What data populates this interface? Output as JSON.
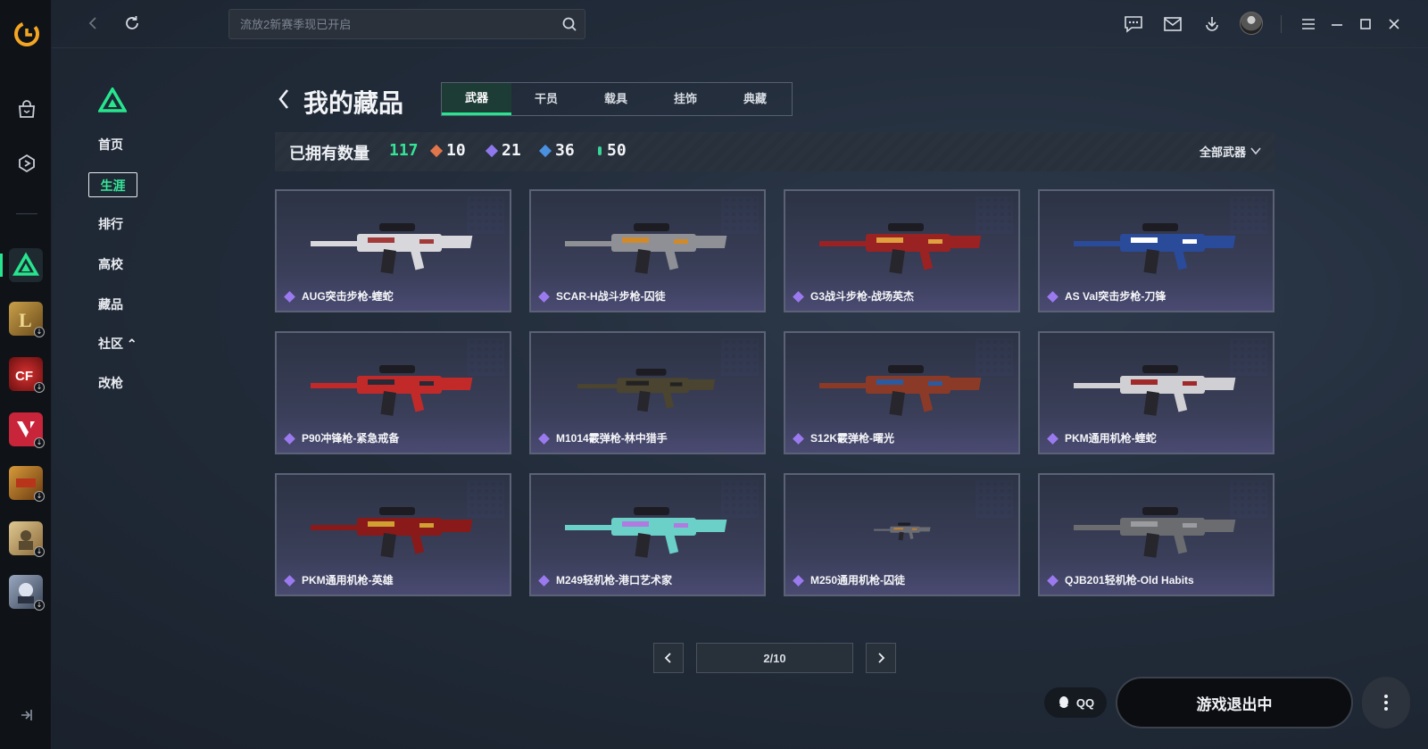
{
  "search": {
    "placeholder": "流放2新赛季现已开启"
  },
  "sidebar_nav": {
    "items": [
      {
        "label": "首页"
      },
      {
        "label": "生涯"
      },
      {
        "label": "排行"
      },
      {
        "label": "高校"
      },
      {
        "label": "藏品"
      },
      {
        "label": "社区 ⌃"
      },
      {
        "label": "改枪"
      }
    ]
  },
  "header": {
    "title": "我的藏品"
  },
  "tabs": [
    {
      "label": "武器",
      "active": true
    },
    {
      "label": "干员",
      "active": false
    },
    {
      "label": "载具",
      "active": false
    },
    {
      "label": "挂饰",
      "active": false
    },
    {
      "label": "典藏",
      "active": false
    }
  ],
  "stats": {
    "label": "已拥有数量",
    "total": "117",
    "counts": [
      {
        "value": "10",
        "color": "#e0764a"
      },
      {
        "value": "21",
        "color": "#8f78ee"
      },
      {
        "value": "36",
        "color": "#4a8fe0"
      },
      {
        "value": "50",
        "color": "#39d49a"
      }
    ],
    "filter_label": "全部武器"
  },
  "items": [
    {
      "name": "AUG突击步枪-蝰蛇",
      "gun_color": "#d8d8dc",
      "accent": "#a23a3a"
    },
    {
      "name": "SCAR-H战斗步枪-囚徒",
      "gun_color": "#8e9096",
      "accent": "#d08a2a"
    },
    {
      "name": "G3战斗步枪-战场英杰",
      "gun_color": "#9a2222",
      "accent": "#e0a040"
    },
    {
      "name": "AS Val突击步枪-刀锋",
      "gun_color": "#2a4a9a",
      "accent": "#ffffff"
    },
    {
      "name": "P90冲锋枪-紧急戒备",
      "gun_color": "#c22a2a",
      "accent": "#2a2a36"
    },
    {
      "name": "M1014霰弹枪-林中猎手",
      "gun_color": "#4a4430",
      "accent": "#222222"
    },
    {
      "name": "S12K霰弹枪-曙光",
      "gun_color": "#8a3a26",
      "accent": "#2a5aa0"
    },
    {
      "name": "PKM通用机枪-蝰蛇",
      "gun_color": "#d0d0d4",
      "accent": "#a02a2a"
    },
    {
      "name": "PKM通用机枪-英雄",
      "gun_color": "#8a1a1a",
      "accent": "#d0a030"
    },
    {
      "name": "M249轻机枪-港口艺术家",
      "gun_color": "#6ad0c8",
      "accent": "#b07ae0"
    },
    {
      "name": "M250通用机枪-囚徒",
      "gun_color": "#6a6c72",
      "accent": "#c08030"
    },
    {
      "name": "QJB201轻机枪-Old Habits",
      "gun_color": "#6a6c70",
      "accent": "#9a9ca0"
    }
  ],
  "pagination": {
    "label": "2/10"
  },
  "footer": {
    "qq_label": "QQ",
    "exit_label": "游戏退出中"
  },
  "colors": {
    "accent_green": "#27e58f"
  },
  "icons": [
    "brand-logo-icon",
    "store-icon",
    "voucher-icon",
    "back-icon",
    "refresh-icon",
    "search-icon",
    "chat-icon",
    "mail-icon",
    "download-icon",
    "menu-icon",
    "minimize-icon",
    "maximize-icon",
    "close-icon",
    "chevron-down-icon",
    "chevron-left-icon",
    "chevron-right-icon",
    "more-icon",
    "qq-icon"
  ]
}
